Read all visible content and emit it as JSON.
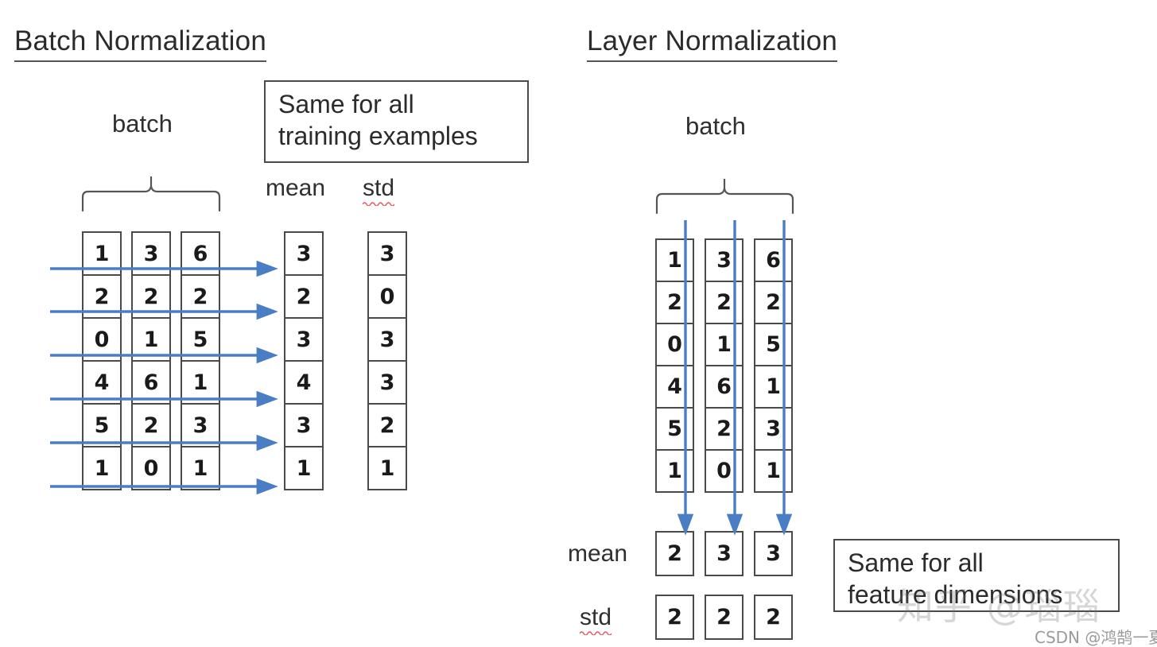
{
  "panels": {
    "batch_norm": {
      "title": "Batch Normalization",
      "batch_label": "batch",
      "mean_label": "mean",
      "std_label": "std",
      "callout": "Same for all\ntraining examples",
      "matrix": {
        "columns": [
          [
            "1",
            "2",
            "0",
            "4",
            "5",
            "1"
          ],
          [
            "3",
            "2",
            "1",
            "6",
            "2",
            "0"
          ],
          [
            "6",
            "2",
            "5",
            "1",
            "3",
            "1"
          ]
        ]
      },
      "mean_column": [
        "3",
        "2",
        "3",
        "4",
        "3",
        "1"
      ],
      "std_column": [
        "3",
        "0",
        "3",
        "3",
        "2",
        "1"
      ],
      "arrow_direction": "horizontal-right",
      "arrow_count": 6
    },
    "layer_norm": {
      "title": "Layer Normalization",
      "batch_label": "batch",
      "mean_label": "mean",
      "std_label": "std",
      "callout": "Same for all\nfeature dimensions",
      "matrix": {
        "columns": [
          [
            "1",
            "2",
            "0",
            "4",
            "5",
            "1"
          ],
          [
            "3",
            "2",
            "1",
            "6",
            "2",
            "0"
          ],
          [
            "6",
            "2",
            "5",
            "1",
            "3",
            "1"
          ]
        ]
      },
      "mean_row": [
        "2",
        "3",
        "3"
      ],
      "std_row": [
        "2",
        "2",
        "2"
      ],
      "arrow_direction": "vertical-down",
      "arrow_count": 3
    }
  },
  "watermarks": {
    "zhihu": "知乎 @瑙瑙",
    "csdn": "CSDN @鸿鹄一夏"
  },
  "colors": {
    "arrow_blue": "#4a7ec4",
    "ink": "#2b2b2b",
    "border": "#4a4a4a",
    "spellcheck_red": "#e8565c"
  },
  "icons": {
    "brace": "curly-brace-icon",
    "arrow": "arrow-icon",
    "squiggle": "spellcheck-squiggle-icon"
  }
}
